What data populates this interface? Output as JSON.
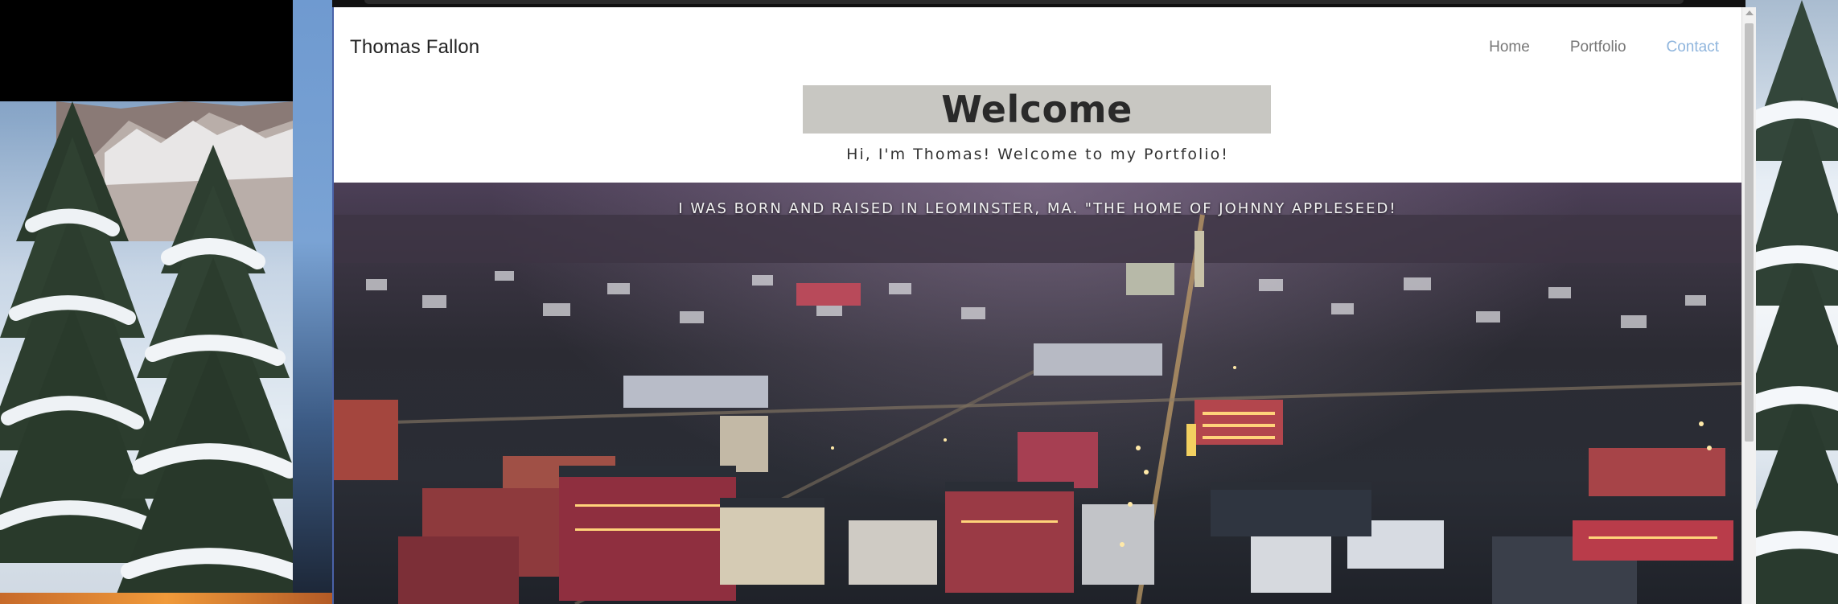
{
  "site": {
    "brand": "Thomas Fallon",
    "nav": [
      {
        "label": "Home",
        "active": false
      },
      {
        "label": "Portfolio",
        "active": false
      },
      {
        "label": "Contact",
        "active": true
      }
    ],
    "accent_color": "#8fb5dd"
  },
  "header": {
    "title": "Welcome",
    "subtitle": "Hi, I'm Thomas! Welcome to my Portfolio!",
    "title_bg_color": "#c8c7c2"
  },
  "hero": {
    "caption": "I WAS BORN AND RAISED IN LEOMINSTER, MA. \"THE HOME OF JOHNNY APPLESEED!"
  }
}
